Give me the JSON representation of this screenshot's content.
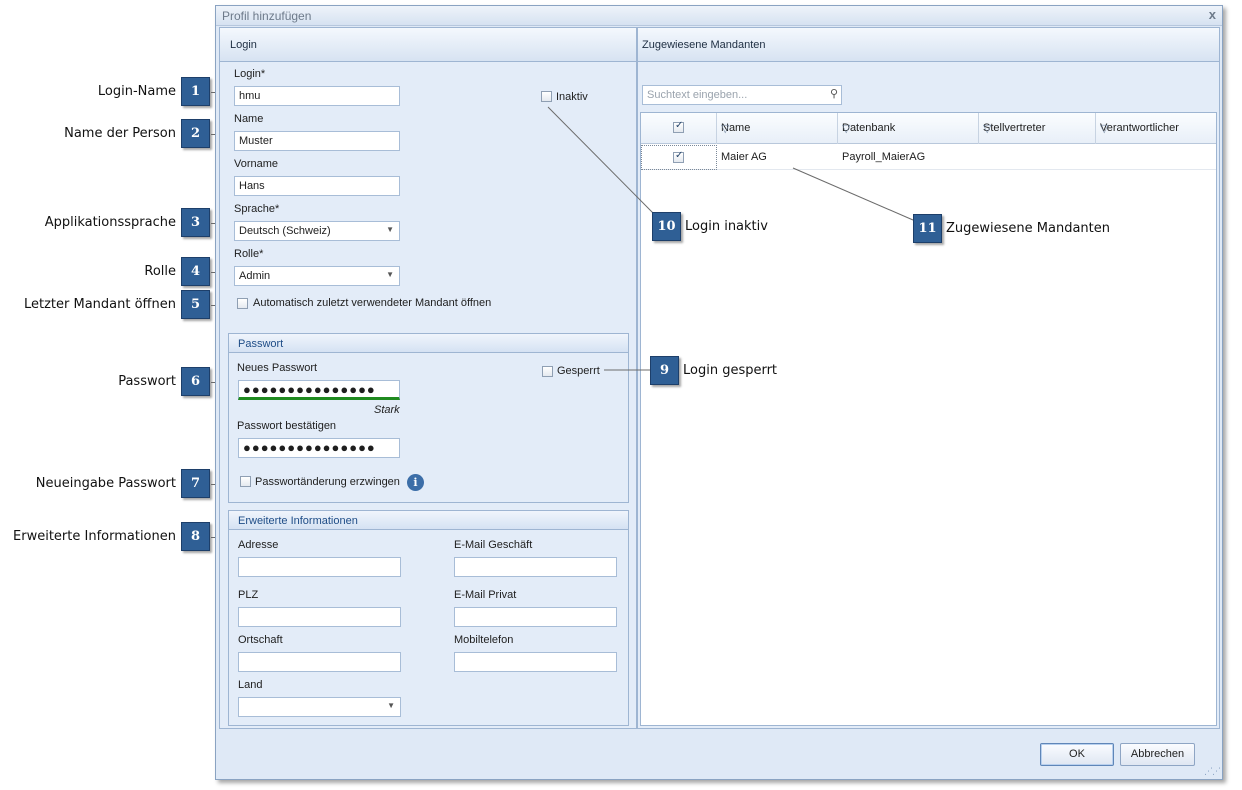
{
  "dialog": {
    "title": "Profil hinzufügen",
    "close_glyph": "x",
    "ok_label": "OK",
    "cancel_label": "Abbrechen"
  },
  "login_panel": {
    "header": "Login",
    "login_label": "Login*",
    "login_value": "hmu",
    "inactive_label": "Inaktiv",
    "name_label": "Name",
    "name_value": "Muster",
    "firstname_label": "Vorname",
    "firstname_value": "Hans",
    "language_label": "Sprache*",
    "language_value": "Deutsch (Schweiz)",
    "role_label": "Rolle*",
    "role_value": "Admin",
    "auto_open_label": "Automatisch zuletzt verwendeter Mandant öffnen"
  },
  "password_group": {
    "header": "Passwort",
    "new_label": "Neues Passwort",
    "new_value": "●●●●●●●●●●●●●●●",
    "strength": "Stark",
    "confirm_label": "Passwort bestätigen",
    "confirm_value": "●●●●●●●●●●●●●●●",
    "locked_label": "Gesperrt",
    "force_change_label": "Passwortänderung erzwingen",
    "info_glyph": "i"
  },
  "extended_group": {
    "header": "Erweiterte Informationen",
    "address_label": "Adresse",
    "zip_label": "PLZ",
    "city_label": "Ortschaft",
    "country_label": "Land",
    "email_business_label": "E-Mail Geschäft",
    "email_private_label": "E-Mail Privat",
    "mobile_label": "Mobiltelefon"
  },
  "mandants_panel": {
    "header": "Zugewiesene Mandanten",
    "search_placeholder": "Suchtext eingeben...",
    "columns": [
      "Name",
      "Datenbank",
      "Stellvertreter",
      "Verantwortlicher"
    ],
    "rows": [
      {
        "checked": true,
        "name": "Maier AG",
        "database": "Payroll_MaierAG",
        "deputy": "",
        "responsible": ""
      }
    ]
  },
  "annotations": {
    "left": [
      {
        "num": "1",
        "text": "Login-Name"
      },
      {
        "num": "2",
        "text": "Name der Person"
      },
      {
        "num": "3",
        "text": "Applikationssprache"
      },
      {
        "num": "4",
        "text": "Rolle"
      },
      {
        "num": "5",
        "text": "Letzter Mandant öffnen"
      },
      {
        "num": "6",
        "text": "Passwort"
      },
      {
        "num": "7",
        "text": "Neueingabe Passwort"
      },
      {
        "num": "8",
        "text": "Erweiterte Informationen"
      }
    ],
    "right": [
      {
        "num": "9",
        "text": "Login gesperrt"
      },
      {
        "num": "10",
        "text": "Login inaktiv"
      },
      {
        "num": "11",
        "text": "Zugewiesene Mandanten"
      }
    ]
  },
  "colors": {
    "badge": "#2f5f95",
    "dialog_bg": "#dfe9f6",
    "strength_bar": "#1f8a1f"
  }
}
